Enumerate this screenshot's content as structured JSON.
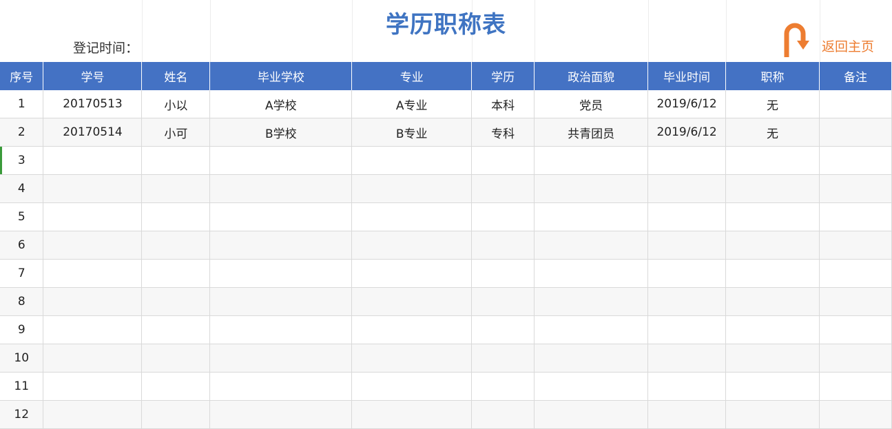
{
  "header": {
    "title": "学历职称表",
    "registration_label": "登记时间：",
    "back_button_label": "返回主页",
    "accent_color": "#4472c4",
    "title_color": "#3f74c2",
    "back_color": "#ed7d31",
    "back_icon": "u-turn-arrow-icon"
  },
  "table": {
    "columns": [
      "序号",
      "学号",
      "姓名",
      "毕业学校",
      "专业",
      "学历",
      "政治面貌",
      "毕业时间",
      "职称",
      "备注"
    ],
    "rows": [
      [
        "1",
        "20170513",
        "小以",
        "A学校",
        "A专业",
        "本科",
        "党员",
        "2019/6/12",
        "无",
        ""
      ],
      [
        "2",
        "20170514",
        "小可",
        "B学校",
        "B专业",
        "专科",
        "共青团员",
        "2019/6/12",
        "无",
        ""
      ],
      [
        "3",
        "",
        "",
        "",
        "",
        "",
        "",
        "",
        "",
        ""
      ],
      [
        "4",
        "",
        "",
        "",
        "",
        "",
        "",
        "",
        "",
        ""
      ],
      [
        "5",
        "",
        "",
        "",
        "",
        "",
        "",
        "",
        "",
        ""
      ],
      [
        "6",
        "",
        "",
        "",
        "",
        "",
        "",
        "",
        "",
        ""
      ],
      [
        "7",
        "",
        "",
        "",
        "",
        "",
        "",
        "",
        "",
        ""
      ],
      [
        "8",
        "",
        "",
        "",
        "",
        "",
        "",
        "",
        "",
        ""
      ],
      [
        "9",
        "",
        "",
        "",
        "",
        "",
        "",
        "",
        "",
        ""
      ],
      [
        "10",
        "",
        "",
        "",
        "",
        "",
        "",
        "",
        "",
        ""
      ],
      [
        "11",
        "",
        "",
        "",
        "",
        "",
        "",
        "",
        "",
        ""
      ],
      [
        "12",
        "",
        "",
        "",
        "",
        "",
        "",
        "",
        "",
        ""
      ]
    ]
  }
}
